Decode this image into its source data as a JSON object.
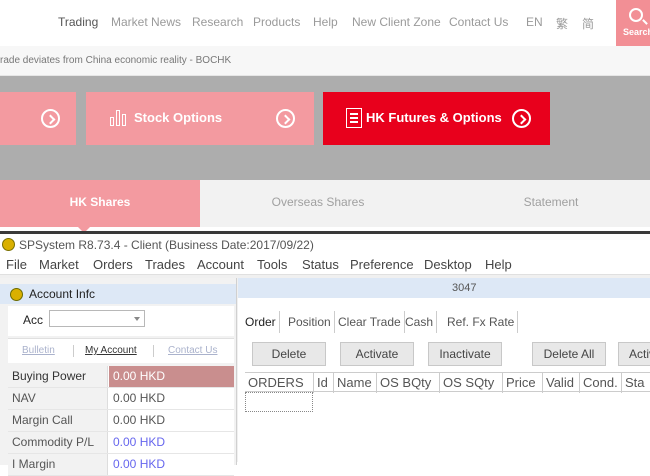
{
  "nav": {
    "items": [
      "Trading",
      "Market News",
      "Research",
      "Products",
      "Help",
      "New Client Zone",
      "Contact Us",
      "EN",
      "繁",
      "简"
    ],
    "search_label": "Search"
  },
  "ticker": "rade deviates from China economic reality - BOCHK",
  "cards": {
    "stock_options": "Stock Options",
    "hk_futures": "HK Futures & Options"
  },
  "tabs": [
    "HK Shares",
    "Overseas Shares",
    "Statement"
  ],
  "window": {
    "title": "SPSystem R8.73.4 - Client (Business Date:2017/09/22)",
    "menu": [
      "File",
      "Market",
      "Orders",
      "Trades",
      "Account",
      "Tools",
      "Status",
      "Preference",
      "Desktop",
      "Help"
    ]
  },
  "account": {
    "header": "Account Infc",
    "acc_label": "Acc",
    "links": [
      "Bulletin",
      "My Account",
      "Contact Us"
    ],
    "rows": [
      {
        "label": "Buying Power",
        "value": "0.00 HKD"
      },
      {
        "label": "NAV",
        "value": "0.00 HKD"
      },
      {
        "label": "Margin Call",
        "value": "0.00 HKD"
      },
      {
        "label": "Commodity P/L",
        "value": "0.00 HKD"
      },
      {
        "label": "I Margin",
        "value": "0.00 HKD"
      }
    ]
  },
  "orders": {
    "header_id": "3047",
    "subtabs": [
      "Order",
      "Position",
      "Clear Trade",
      "Cash",
      "Ref. Fx Rate"
    ],
    "buttons": [
      "Delete",
      "Activate",
      "Inactivate",
      "Delete All",
      "Activ"
    ],
    "columns": [
      "ORDERS",
      "Id",
      "Name",
      "OS BQty",
      "OS SQty",
      "Price",
      "Valid",
      "Cond.",
      "Sta"
    ]
  }
}
